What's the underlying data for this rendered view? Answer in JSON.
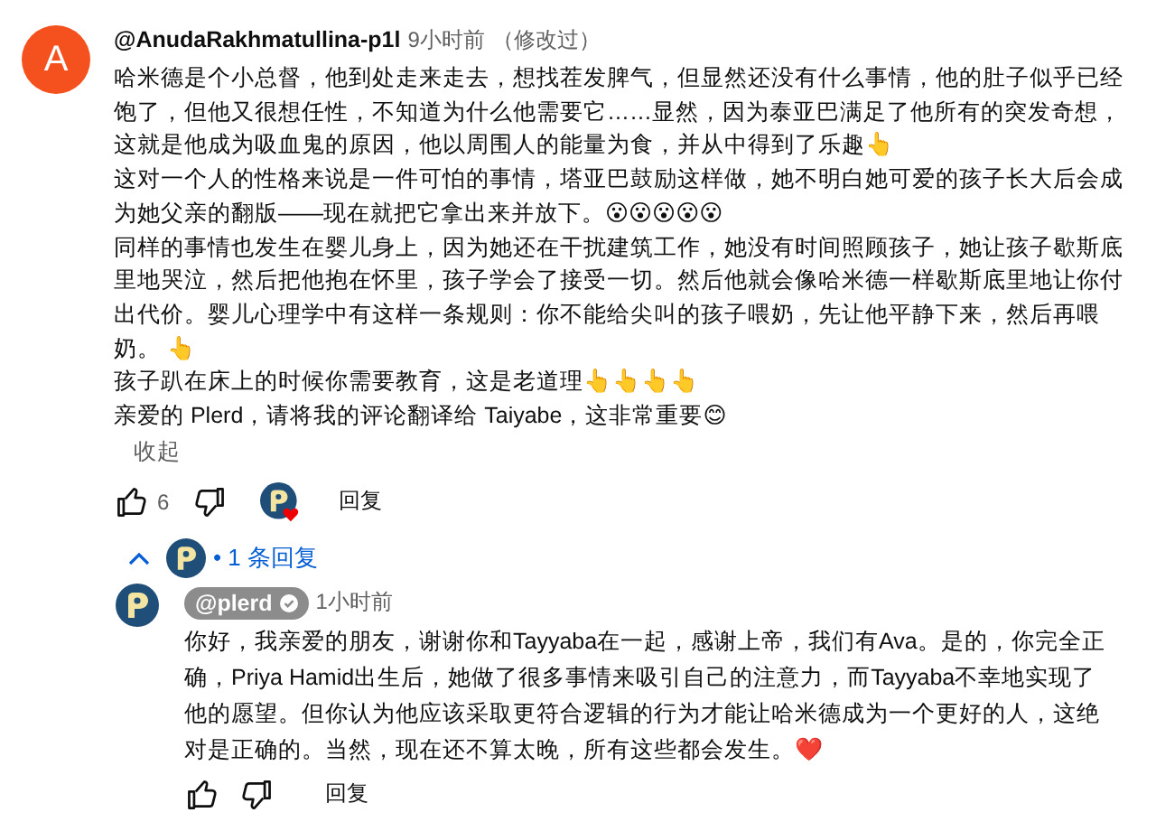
{
  "comment": {
    "author": {
      "initial": "A",
      "handle": "@AnudaRakhmatullina-p1l"
    },
    "time": "9小时前",
    "edited": "（修改过）",
    "paragraphs": [
      {
        "text": "哈米德是个小总督，他到处走来走去，想找茬发脾气，但显然还没有什么事情，他的肚子似乎已经饱了，但他又很想任性，不知道为什么他需要它……显然，因为泰亚巴满足了他所有的突发奇想，这就是他成为吸血鬼的原因，他以周围人的能量为食，并从中得到了乐趣👆"
      },
      {
        "text": "这对一个人的性格来说是一件可怕的事情，塔亚巴鼓励这样做，她不明白她可爱的孩子长大后会成为她父亲的翻版——现在就把它拿出来并放下。😮😮😮😮😮"
      },
      {
        "text": "同样的事情也发生在婴儿身上，因为她还在干扰建筑工作，她没有时间照顾孩子，她让孩子歇斯底里地哭泣，然后把他抱在怀里，孩子学会了接受一切。然后他就会像哈米德一样歇斯底里地让你付出代价。婴儿心理学中有这样一条规则：你不能给尖叫的孩子喂奶，先让他平静下来，然后再喂奶。 👆"
      },
      {
        "text": "孩子趴在床上的时候你需要教育，这是老道理👆👆👆👆"
      },
      {
        "text": "亲爱的 Plerd，请将我的评论翻译给 Taiyabe，这非常重要😊"
      }
    ],
    "collapse": "收起",
    "likes": "6",
    "creator_hearted": true,
    "reply_button": "回复"
  },
  "replies_toggle": {
    "expanded": true,
    "label": "• 1 条回复"
  },
  "replies": [
    {
      "handle": "@plerd",
      "verified": true,
      "time": "1小时前",
      "text": "你好，我亲爱的朋友，谢谢你和Tayyaba在一起，感谢上帝，我们有Ava。是的，你完全正确，Priya Hamid出生后，她做了很多事情来吸引自己的注意力，而Tayyaba不幸地实现了他的愿望。但你认为他应该采取更符合逻辑的行为才能让哈米德成为一个更好的人，这绝对是正确的。当然，现在还不算太晚，所有这些都会发生。❤️",
      "reply_button": "回复"
    }
  ]
}
